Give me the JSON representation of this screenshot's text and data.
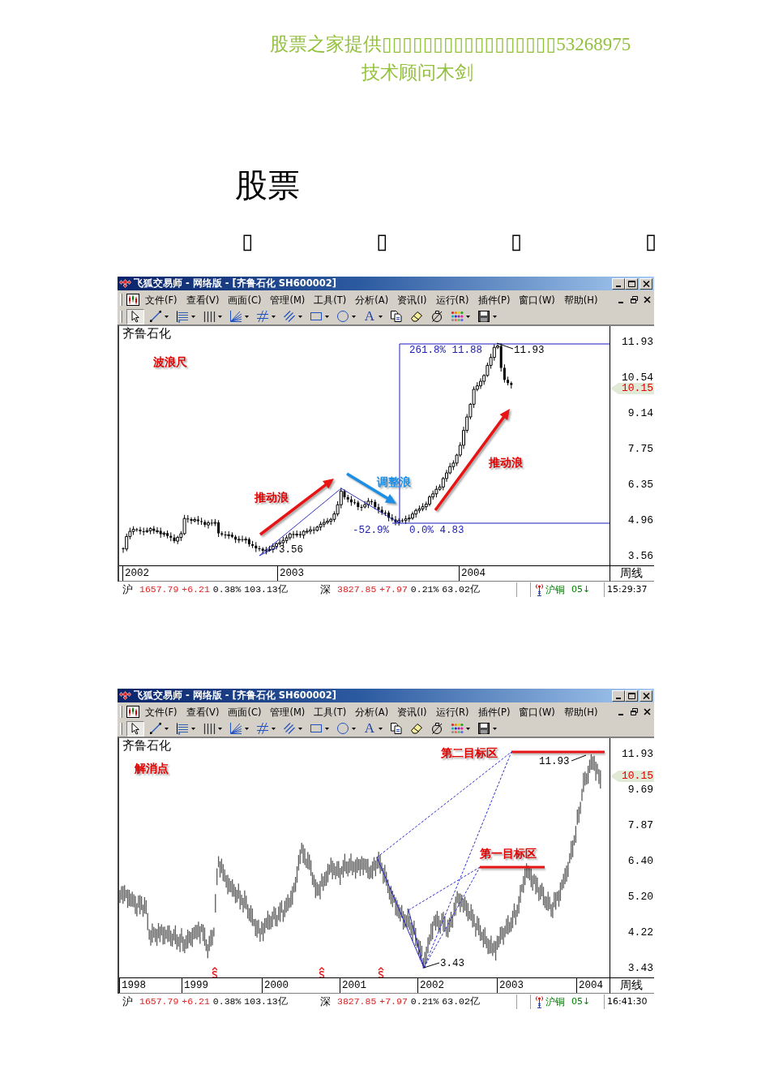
{
  "header": {
    "lines": [
      "股票之家提供▯▯▯▯▯▯▯▯▯▯▯▯▯▯▯▯▯53268975",
      "技术顾问木剑"
    ]
  },
  "title": "股票",
  "title_marks": [
    "▯",
    "▯",
    "▯",
    "▯"
  ],
  "windows": [
    {
      "title": "飞狐交易师 - 网络版 - [齐鲁石化 SH600002]",
      "menus": [
        "文件(F)",
        "查看(V)",
        "画面(C)",
        "管理(M)",
        "工具(T)",
        "分析(A)",
        "资讯(I)",
        "运行(R)",
        "插件(P)",
        "窗口(W)",
        "帮助(H)"
      ],
      "toolbar": [
        {
          "kind": "pointer",
          "selected": true,
          "dropdown": false
        },
        {
          "kind": "line",
          "selected": false,
          "dropdown": true
        },
        {
          "kind": "levels",
          "selected": false,
          "dropdown": true
        },
        {
          "kind": "cycles",
          "selected": false,
          "dropdown": true
        },
        {
          "kind": "fan",
          "selected": false,
          "dropdown": true
        },
        {
          "kind": "channel",
          "selected": false,
          "dropdown": true
        },
        {
          "kind": "hatch",
          "selected": false,
          "dropdown": true
        },
        {
          "kind": "rectangle",
          "selected": false,
          "dropdown": true
        },
        {
          "kind": "ellipse",
          "selected": false,
          "dropdown": true
        },
        {
          "kind": "text",
          "label": "A",
          "selected": false,
          "dropdown": true
        },
        {
          "kind": "copy",
          "selected": false,
          "dropdown": false
        },
        {
          "kind": "eraser",
          "selected": false,
          "dropdown": false
        },
        {
          "kind": "lock",
          "selected": false,
          "dropdown": false
        },
        {
          "kind": "palette",
          "selected": false,
          "dropdown": true
        },
        {
          "kind": "save",
          "selected": false,
          "dropdown": true
        }
      ],
      "chart": {
        "kind": "wave",
        "stock": "齐鲁石化",
        "labels": [
          {
            "kind": "heading",
            "text": "波浪尺"
          },
          {
            "kind": "ratio",
            "text": "261.8% 11.88"
          },
          {
            "kind": "price",
            "text": "11.93"
          },
          {
            "kind": "impulse",
            "text": "推动浪"
          },
          {
            "kind": "correction",
            "text": "调整浪"
          },
          {
            "kind": "impulse",
            "text": "推动浪"
          },
          {
            "kind": "ratio",
            "text": "-52.9%"
          },
          {
            "kind": "ratio",
            "text": "0.0% 4.83"
          },
          {
            "kind": "price",
            "text": "3.56"
          }
        ],
        "price_labels": [
          "11.93",
          "10.54",
          "9.14",
          "7.75",
          "6.35",
          "4.96",
          "3.56"
        ],
        "last_price": "10.15",
        "date_labels": [
          "2002",
          "2003",
          "2004"
        ],
        "period": "周线"
      },
      "status": {
        "markets": [
          {
            "name": "沪",
            "index": "1657.79",
            "change": "+6.21",
            "percent": "0.38%",
            "turnover": "103.13亿",
            "rising": true
          },
          {
            "name": "深",
            "index": "3827.85",
            "change": "+7.97",
            "percent": "0.21%",
            "turnover": "63.02亿",
            "rising": true
          }
        ],
        "ticker": {
          "name": "沪铜",
          "value": "05↓",
          "rising": false
        },
        "time": "15:29:37"
      }
    },
    {
      "title": "飞狐交易师 - 网络版 - [齐鲁石化 SH600002]",
      "menus": [
        "文件(F)",
        "查看(V)",
        "画面(C)",
        "管理(M)",
        "工具(T)",
        "分析(A)",
        "资讯(I)",
        "运行(R)",
        "插件(P)",
        "窗口(W)",
        "帮助(H)"
      ],
      "toolbar": [
        {
          "kind": "pointer",
          "selected": true,
          "dropdown": false
        },
        {
          "kind": "line",
          "selected": false,
          "dropdown": true
        },
        {
          "kind": "levels",
          "selected": false,
          "dropdown": true
        },
        {
          "kind": "cycles",
          "selected": false,
          "dropdown": true
        },
        {
          "kind": "fan",
          "selected": false,
          "dropdown": true
        },
        {
          "kind": "channel",
          "selected": false,
          "dropdown": true
        },
        {
          "kind": "hatch",
          "selected": false,
          "dropdown": true
        },
        {
          "kind": "rectangle",
          "selected": false,
          "dropdown": true
        },
        {
          "kind": "ellipse",
          "selected": false,
          "dropdown": true
        },
        {
          "kind": "text",
          "label": "A",
          "selected": false,
          "dropdown": true
        },
        {
          "kind": "copy",
          "selected": false,
          "dropdown": false
        },
        {
          "kind": "eraser",
          "selected": false,
          "dropdown": false
        },
        {
          "kind": "lock",
          "selected": false,
          "dropdown": false
        },
        {
          "kind": "palette",
          "selected": false,
          "dropdown": true
        },
        {
          "kind": "save",
          "selected": false,
          "dropdown": true
        }
      ],
      "chart": {
        "kind": "targets",
        "stock": "齐鲁石化",
        "labels": [
          {
            "kind": "heading",
            "text": "解消点"
          },
          {
            "kind": "target",
            "text": "第二目标区"
          },
          {
            "kind": "price",
            "text": "11.93"
          },
          {
            "kind": "target",
            "text": "第一目标区"
          },
          {
            "kind": "price",
            "text": "3.43"
          }
        ],
        "price_labels": [
          "11.93",
          "9.69",
          "7.87",
          "6.40",
          "5.20",
          "4.22",
          "3.43"
        ],
        "last_price": "10.15",
        "date_labels": [
          "1998",
          "1999",
          "2000",
          "2001",
          "2002",
          "2003",
          "2004"
        ],
        "period": "周线"
      },
      "status": {
        "markets": [
          {
            "name": "沪",
            "index": "1657.79",
            "change": "+6.21",
            "percent": "0.38%",
            "turnover": "103.13亿",
            "rising": true
          },
          {
            "name": "深",
            "index": "3827.85",
            "change": "+7.97",
            "percent": "0.21%",
            "turnover": "63.02亿",
            "rising": true
          }
        ],
        "ticker": {
          "name": "沪铜",
          "value": "05↓",
          "rising": false
        },
        "time": "16:41:30"
      }
    }
  ]
}
